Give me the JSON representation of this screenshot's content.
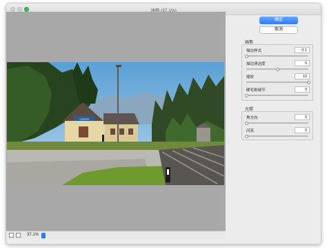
{
  "window": {
    "title": "油画 (37.1%)"
  },
  "buttons": {
    "ok_label": "确定",
    "cancel_label": "取消"
  },
  "brush": {
    "section_label": "画笔",
    "params": [
      {
        "label": "描边样式",
        "value": "0.1",
        "level": 0.0
      },
      {
        "label": "描边清洁度",
        "value": "5",
        "level": 0.5
      },
      {
        "label": "缩放",
        "value": "10",
        "level": 1.0
      },
      {
        "label": "硬毛刷细节",
        "value": "0",
        "level": 0.0
      }
    ]
  },
  "lighting": {
    "section_label": "光照",
    "params": [
      {
        "label": "角方向",
        "value": "0",
        "level": 0.0
      },
      {
        "label": "闪亮",
        "value": "0",
        "level": 0.0
      }
    ]
  },
  "statusbar": {
    "zoom": "37.1%"
  },
  "photo": {
    "sign_text": "Loučná"
  }
}
